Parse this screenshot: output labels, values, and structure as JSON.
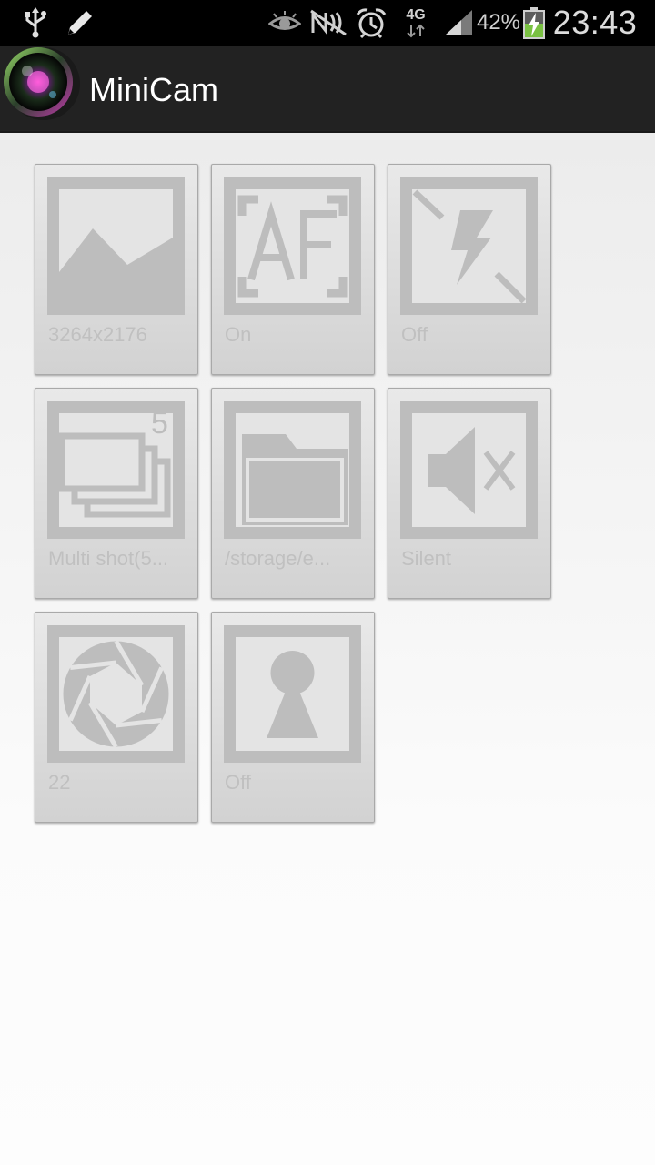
{
  "status_bar": {
    "icons": [
      "usb-icon",
      "pencil-icon",
      "eye-icon",
      "nfc-icon",
      "alarm-icon",
      "4g-data-icon",
      "signal-icon",
      "battery-charging-icon"
    ],
    "network_type": "4G",
    "battery_percent": "42%",
    "time": "23:43"
  },
  "action_bar": {
    "title": "MiniCam",
    "logo_icon": "camera-lens-icon"
  },
  "settings": [
    {
      "icon": "image-resolution-icon",
      "value": "3264x2176"
    },
    {
      "icon": "autofocus-icon",
      "value": "On"
    },
    {
      "icon": "flash-off-icon",
      "value": "Off"
    },
    {
      "icon": "multi-shot-icon",
      "badge": "5",
      "value": "Multi shot(5..."
    },
    {
      "icon": "folder-icon",
      "value": "/storage/e..."
    },
    {
      "icon": "sound-mute-icon",
      "value": "Silent"
    },
    {
      "icon": "aperture-icon",
      "value": "22"
    },
    {
      "icon": "self-timer-person-icon",
      "value": "Off"
    }
  ],
  "colors": {
    "status_bar_bg": "#000000",
    "action_bar_bg": "#222222",
    "tile_icon_fg": "#bdbdbd",
    "tile_label": "#c0c0c0"
  }
}
